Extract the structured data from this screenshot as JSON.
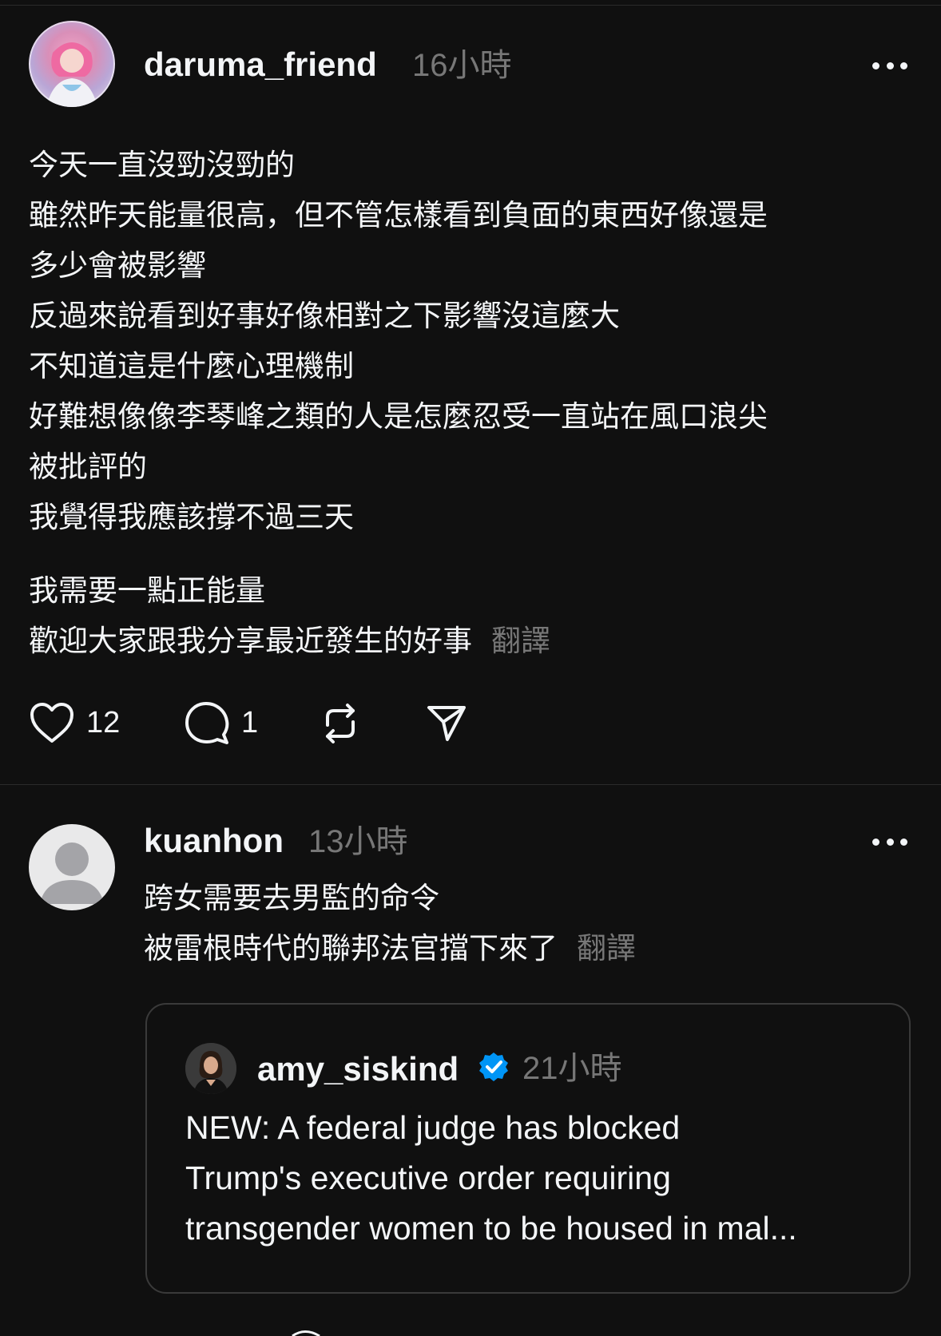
{
  "posts": [
    {
      "username": "daruma_friend",
      "time": "16小時",
      "avatar": "user-photo-avatar",
      "lines": [
        "今天一直沒勁沒勁的",
        "雖然昨天能量很高，但不管怎樣看到負面的東西好像還是",
        "多少會被影響",
        "反過來說看到好事好像相對之下影響沒這麼大",
        "不知道這是什麼心理機制",
        "好難想像像李琴峰之類的人是怎麼忍受一直站在風口浪尖",
        "被批評的",
        "我覺得我應該撐不過三天"
      ],
      "lines2": [
        "我需要一點正能量",
        "歡迎大家跟我分享最近發生的好事"
      ],
      "translate": "翻譯",
      "likes": "12",
      "comments": "1"
    },
    {
      "username": "kuanhon",
      "time": "13小時",
      "avatar": "default-avatar",
      "lines": [
        "跨女需要去男監的命令",
        "被雷根時代的聯邦法官擋下來了"
      ],
      "translate": "翻譯",
      "quote": {
        "username": "amy_siskind",
        "verified": true,
        "time": "21小時",
        "lines": [
          "NEW: A federal judge has blocked",
          "Trump's executive order requiring",
          "transgender women to be housed in mal..."
        ]
      }
    }
  ],
  "colors": {
    "background": "#101010",
    "text": "#f3f5f7",
    "muted": "#777777",
    "verified": "#0095f6"
  }
}
